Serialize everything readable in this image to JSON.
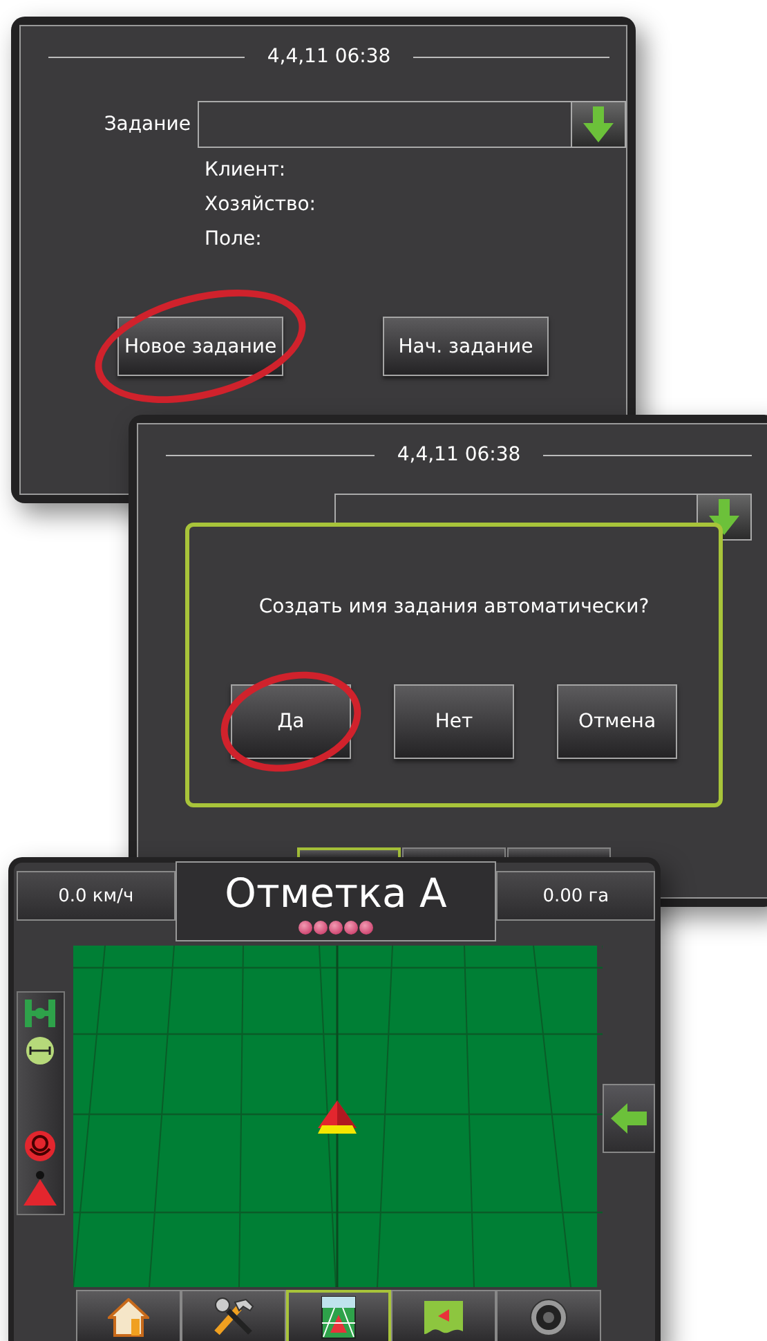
{
  "job_screen": {
    "datetime": "4,4,11 06:38",
    "job_label": "Задание",
    "fields": [
      "Клиент:",
      "Хозяйство:",
      "Поле:"
    ],
    "buttons": [
      {
        "label": "Новое задание",
        "circled": true
      },
      {
        "label": "Нач. задание",
        "circled": false
      }
    ]
  },
  "auto_name_screen": {
    "datetime": "4,4,11 06:38",
    "dialog": {
      "message": "Создать имя задания автоматически?",
      "buttons": [
        {
          "label": "Да",
          "circled": true
        },
        {
          "label": "Нет",
          "circled": false
        },
        {
          "label": "Отмена",
          "circled": false
        }
      ]
    },
    "tabs": [
      {
        "selected": true
      },
      {
        "selected": false
      },
      {
        "selected": false
      }
    ]
  },
  "guidance_screen": {
    "speed": "0.0 км/ч",
    "title": "Отметка A",
    "area": "0.00 га",
    "tabs": [
      {
        "kind": "home",
        "selected": false
      },
      {
        "kind": "tools",
        "selected": false
      },
      {
        "kind": "guidance",
        "selected": true
      },
      {
        "kind": "map",
        "selected": false
      },
      {
        "kind": "camera",
        "selected": false
      }
    ]
  }
}
